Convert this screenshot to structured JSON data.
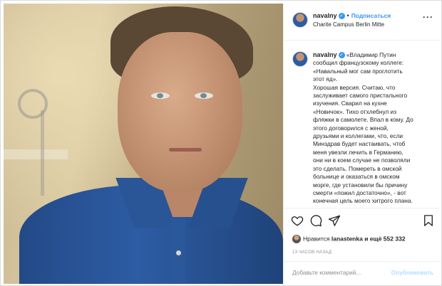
{
  "post": {
    "username": "navalny",
    "verified": true,
    "follow_label": "Подписаться",
    "location": "Charite Campus Berlin Mitte",
    "caption_lines": [
      "«Владимир Путин",
      "сообщил французскому коллеге:",
      "«Навальный мог сам проглотить",
      "этот яд».",
      "Хорошая версия. Считаю, что",
      "заслуживает самого пристального",
      "изучения. Сварил на кухне",
      "«Новичок». Тихо отхлебнул из",
      "фляжки в самолете. Впал в кому. До",
      "этого договорился с женой,",
      "друзьями и коллегами, что, если",
      "Минздрав будет настаивать, чтоб",
      "меня увезли лечить в Германию,",
      "они ни в коем случае не позволяли",
      "это сделать. Помереть в омской",
      "больнице и оказаться в омском",
      "морге, где установили бы причину",
      "смерти «пожил достаточно», - вот",
      "конечная цель моего хитрого плана."
    ],
    "likes": {
      "prefix": "Нравится",
      "user": "lanastenka",
      "suffix": "и ещё 552 332"
    },
    "time_ago": "13 ЧАСОВ НАЗАД",
    "comment": {
      "placeholder": "Добавьте комментарий...",
      "publish_label": "Опубликовать"
    }
  },
  "icons": {
    "more": "more-icon",
    "like": "heart-icon",
    "comment": "comment-icon",
    "share": "share-icon",
    "save": "bookmark-icon",
    "verified": "verified-badge-icon"
  },
  "colors": {
    "link": "#3897f0",
    "publish_disabled": "#b3dbff",
    "muted": "#8e8e8e",
    "text": "#262626"
  }
}
